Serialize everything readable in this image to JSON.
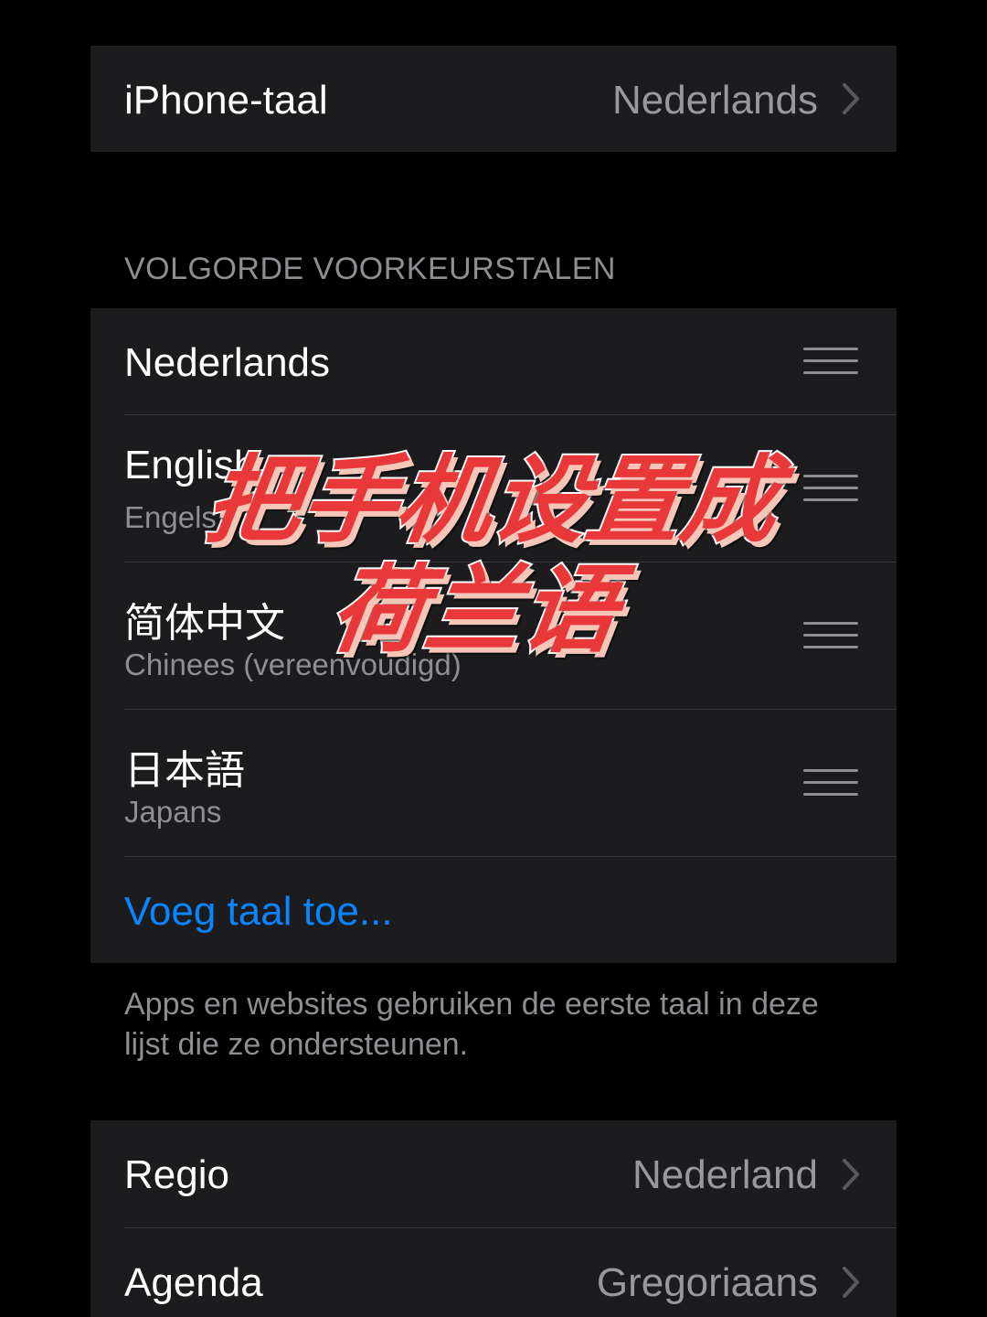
{
  "language_row": {
    "label": "iPhone-taal",
    "value": "Nederlands"
  },
  "preferred_section": {
    "header": "VOLGORDE VOORKEURSTALEN",
    "languages": [
      {
        "name": "Nederlands",
        "sub": ""
      },
      {
        "name": "English",
        "sub": "Engels"
      },
      {
        "name": "简体中文",
        "sub": "Chinees (vereenvoudigd)"
      },
      {
        "name": "日本語",
        "sub": "Japans"
      }
    ],
    "add_language": "Voeg taal toe...",
    "footer": "Apps en websites gebruiken de eerste taal in deze lijst die ze ondersteunen."
  },
  "region_row": {
    "label": "Regio",
    "value": "Nederland"
  },
  "calendar_row": {
    "label": "Agenda",
    "value": "Gregoriaans"
  },
  "overlay": {
    "line1": "把手机设置成",
    "line2": "荷兰语"
  },
  "colors": {
    "background": "#000000",
    "group": "#1c1c1e",
    "accent_link": "#0a84ff",
    "secondary_text": "#8e8e93",
    "overlay_text": "#e8383a"
  },
  "icons": [
    "chevron-right-icon",
    "reorder-handle-icon"
  ]
}
